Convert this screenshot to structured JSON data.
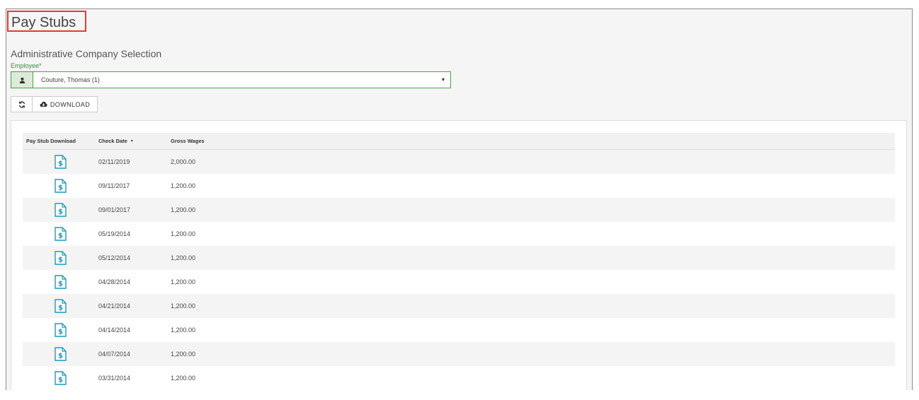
{
  "page": {
    "title": "Pay Stubs"
  },
  "selection": {
    "section_title": "Administrative Company Selection",
    "employee_label": "Employee*",
    "employee_value": "Couture, Thomas (1)"
  },
  "toolbar": {
    "download_label": "DOWNLOAD"
  },
  "table": {
    "headers": {
      "stub": "Pay Stub Download",
      "check_date": "Check Date",
      "gross_wages": "Gross Wages"
    },
    "rows": [
      {
        "check_date": "02/11/2019",
        "gross_wages": "2,000.00"
      },
      {
        "check_date": "09/11/2017",
        "gross_wages": "1,200.00"
      },
      {
        "check_date": "09/01/2017",
        "gross_wages": "1,200.00"
      },
      {
        "check_date": "05/19/2014",
        "gross_wages": "1,200.00"
      },
      {
        "check_date": "05/12/2014",
        "gross_wages": "1,200.00"
      },
      {
        "check_date": "04/28/2014",
        "gross_wages": "1,200.00"
      },
      {
        "check_date": "04/21/2014",
        "gross_wages": "1,200.00"
      },
      {
        "check_date": "04/14/2014",
        "gross_wages": "1,200.00"
      },
      {
        "check_date": "04/07/2014",
        "gross_wages": "1,200.00"
      },
      {
        "check_date": "03/31/2014",
        "gross_wages": "1,200.00"
      }
    ]
  },
  "colors": {
    "accent_green": "#4a9e4a",
    "icon_teal": "#1a9bb8",
    "highlight_red": "#e03c31"
  },
  "icons": {
    "employee_addon": "user-icon",
    "refresh": "refresh-icon",
    "download": "cloud-download-icon",
    "stub": "dollar-document-icon",
    "sort": "sort-caret-icon"
  }
}
